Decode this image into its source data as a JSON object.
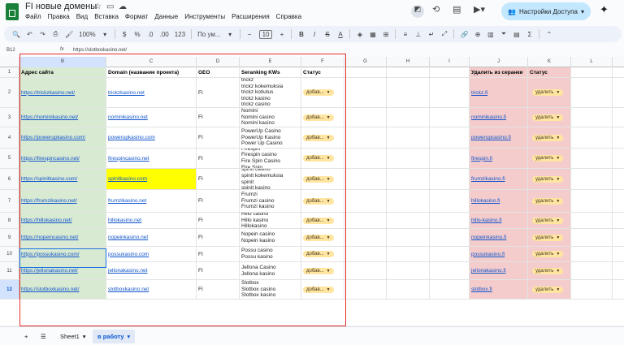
{
  "app": {
    "title": "FI новые домены"
  },
  "menu": [
    "Файл",
    "Правка",
    "Вид",
    "Вставка",
    "Формат",
    "Данные",
    "Инструменты",
    "Расширения",
    "Справка"
  ],
  "share": {
    "label": "Настройки Доступа"
  },
  "toolbar": {
    "zoom": "100%",
    "currency": "$",
    "percent": "%",
    "dec_less": ".0",
    "dec_more": ".00",
    "num": "123",
    "font": "По ум...",
    "size": "10"
  },
  "formula": {
    "cell": "B12",
    "value": "https://slotboxkasino.net/"
  },
  "columns": [
    "A",
    "B",
    "C",
    "D",
    "E",
    "F",
    "G",
    "H",
    "I",
    "J",
    "K",
    "L"
  ],
  "headers": {
    "b": "Адрес сайта",
    "c": "Domain (название проекта)",
    "d": "GEO",
    "e": "Seranking KWs",
    "f": "Статус",
    "j": "Удалить из серанки",
    "k": "Статус"
  },
  "rows": [
    {
      "n": "2",
      "url": "https://trickzkasino.net/",
      "domain": "trickzkasino.net",
      "geo": "FI",
      "kws": [
        "trickz",
        "trickz kokemuksia",
        "trickz kotiutus",
        "trickz kasino",
        "trickz casino"
      ],
      "status": "добав...",
      "del": "trickz.fi",
      "dstat": "удалить"
    },
    {
      "n": "3",
      "url": "https://nominikasino.net/",
      "domain": "nominikasino.net",
      "geo": "FI",
      "kws": [
        "Nomini",
        "Nomini casino",
        "Nomini kasino"
      ],
      "status": "добав...",
      "del": "nominikasino.fi",
      "dstat": "удалить"
    },
    {
      "n": "4",
      "url": "https://powerupkasino.com/",
      "domain": "powerupkasino.com",
      "geo": "FI",
      "kws": [
        "PowerUp Casino",
        "PowerUp Kasino",
        "Power Up Casino"
      ],
      "status": "добав...",
      "del": "powerupcasino.fi",
      "dstat": "удалить"
    },
    {
      "n": "5",
      "url": "https://firespincasino.net/",
      "domain": "firespincasino.net",
      "geo": "FI",
      "kws": [
        "Firespin",
        "Firespin casino",
        "Fire Spin Casino",
        "Fire Spin"
      ],
      "status": "добав...",
      "del": "firespin.fi",
      "dstat": "удалить"
    },
    {
      "n": "6",
      "url": "https://spinitkasino.com/",
      "domain": "spinitkasino.com",
      "geo": "FI",
      "kws": [
        "spinit casino",
        "spinit kokemuksia",
        "spinit",
        "spinit kasino"
      ],
      "status": "добав...",
      "del": "frumzikasino.fi",
      "dstat": "удалить"
    },
    {
      "n": "7",
      "url": "https://frumzikasino.net/",
      "domain": "frumzikasino.net",
      "geo": "FI",
      "kws": [
        "Frumzi",
        "Frumzi casino",
        "Frumzi kasino"
      ],
      "status": "добав...",
      "del": "hillokasino.fi",
      "dstat": "удалить"
    },
    {
      "n": "8",
      "url": "https://hillokasino.net/",
      "domain": "hillokasino.net",
      "geo": "FI",
      "kws": [
        "Hillo casino",
        "Hillo kasino",
        "Hillokasino"
      ],
      "status": "добав...",
      "del": "hillo-kasino.fi",
      "dstat": "удалить"
    },
    {
      "n": "9",
      "url": "https://nopeincasino.net/",
      "domain": "nopeinkasino.net",
      "geo": "FI",
      "kws": [
        "Nopein casino",
        "Nopein kasino"
      ],
      "status": "добав...",
      "del": "nopeinkasino.fi",
      "dstat": "удалить"
    },
    {
      "n": "10",
      "url": "https://possukasino.com/",
      "domain": "possukasino.com",
      "geo": "FI",
      "kws": [
        "Possu casino",
        "Possu kasino"
      ],
      "status": "добав...",
      "del": "possukasino.fi",
      "dstat": "удалить"
    },
    {
      "n": "11",
      "url": "https://jellonakasino.net/",
      "domain": "jellonakasino.net",
      "geo": "FI",
      "kws": [
        "Jellona Casino",
        "Jellona kasino"
      ],
      "status": "добав...",
      "del": "jellonakasino.fi",
      "dstat": "удалить"
    },
    {
      "n": "12",
      "url": "https://slotboxkasino.net/",
      "domain": "slotboxkasino.net",
      "geo": "FI",
      "kws": [
        "Slotbox",
        "Slotbox casino",
        "Slotbox kasino"
      ],
      "status": "добав...",
      "del": "slotbox.fi",
      "dstat": "удалить"
    }
  ],
  "tabs": {
    "sheet1": "Sheet1",
    "active": "в работу"
  }
}
